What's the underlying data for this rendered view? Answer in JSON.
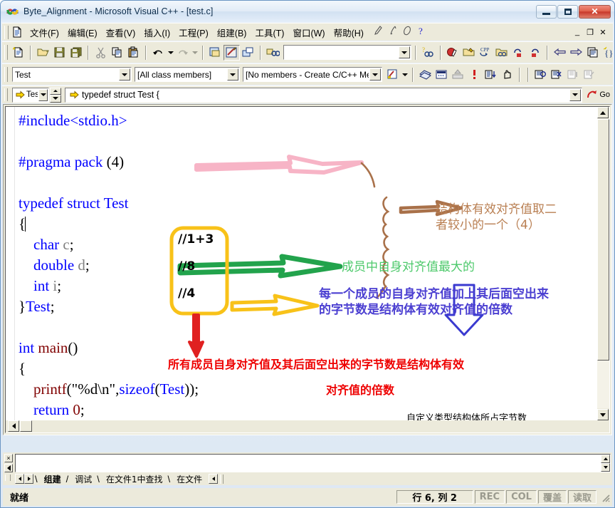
{
  "window": {
    "title": "Byte_Alignment - Microsoft Visual C++ - [test.c]",
    "app_icon": "vcpp-logo-icon",
    "minimize_label": "",
    "maximize_label": "",
    "close_label": "✕"
  },
  "menubar": {
    "items": [
      {
        "label": "文件(F)"
      },
      {
        "label": "编辑(E)"
      },
      {
        "label": "查看(V)"
      },
      {
        "label": "插入(I)"
      },
      {
        "label": "工程(P)"
      },
      {
        "label": "组建(B)"
      },
      {
        "label": "工具(T)"
      },
      {
        "label": "窗口(W)"
      },
      {
        "label": "帮助(H)"
      }
    ],
    "mdi_restore": "_",
    "mdi_max": "❐",
    "mdi_close": "✕"
  },
  "toolbar_standard": {
    "search_value": "",
    "icons": [
      "new-text-file-icon",
      "open-folder-icon",
      "save-icon",
      "save-all-icon",
      "cut-icon",
      "copy-icon",
      "paste-icon",
      "undo-icon",
      "redo-icon",
      "workspace-icon",
      "output-window-icon",
      "window-list-icon",
      "find-in-files-icon",
      "find-icon",
      "help-find-icon"
    ]
  },
  "toolbar_build": {
    "icons": [
      "compile-icon",
      "build-icon",
      "stop-build-icon",
      "execute-icon",
      "go-icon",
      "insert-breakpoint-icon",
      "toggle-breakpoint-icon",
      "remove-breakpoints-icon",
      "bookmark-icon",
      "edit-icon"
    ]
  },
  "toolbar_wizard": {
    "class_value": "Test",
    "filter_value": "[All class members]",
    "member_value": "[No members - Create C/C++ Memb",
    "icons": [
      "class-view-icon",
      "dropdown-icon"
    ]
  },
  "wizardbar": {
    "scope_value": "Tes",
    "location_value": "typedef struct Test {",
    "go_label": "Go",
    "icons": [
      "yellow-arrow-icon",
      "spinner-icon",
      "go-arrow-icon"
    ]
  },
  "editor": {
    "filename": "test.c",
    "code_lines": [
      {
        "tokens": [
          {
            "t": "#include",
            "c": "kw"
          },
          {
            "t": "<stdio.h>",
            "c": "kw"
          }
        ]
      },
      {
        "tokens": []
      },
      {
        "tokens": [
          {
            "t": "#pragma pack",
            "c": "kw"
          },
          {
            "t": " (4)",
            "c": "id"
          }
        ]
      },
      {
        "tokens": []
      },
      {
        "tokens": [
          {
            "t": "typedef struct",
            "c": "kw"
          },
          {
            "t": " ",
            "c": "id"
          },
          {
            "t": "Test",
            "c": "kw"
          }
        ]
      },
      {
        "tokens": [
          {
            "t": "{",
            "c": "id"
          }
        ],
        "cursor": true
      },
      {
        "tokens": [
          {
            "t": "    ",
            "c": "id"
          },
          {
            "t": "char",
            "c": "kw"
          },
          {
            "t": " ",
            "c": "id"
          },
          {
            "t": "c",
            "c": "gray"
          },
          {
            "t": ";",
            "c": "id"
          }
        ]
      },
      {
        "tokens": [
          {
            "t": "    ",
            "c": "id"
          },
          {
            "t": "double",
            "c": "kw"
          },
          {
            "t": " ",
            "c": "id"
          },
          {
            "t": "d",
            "c": "gray"
          },
          {
            "t": ";",
            "c": "id"
          }
        ]
      },
      {
        "tokens": [
          {
            "t": "    ",
            "c": "id"
          },
          {
            "t": "int",
            "c": "kw"
          },
          {
            "t": " ",
            "c": "id"
          },
          {
            "t": "i",
            "c": "gray"
          },
          {
            "t": ";",
            "c": "id"
          }
        ]
      },
      {
        "tokens": [
          {
            "t": "}",
            "c": "id"
          },
          {
            "t": "Test",
            "c": "kw"
          },
          {
            "t": ";",
            "c": "id"
          }
        ]
      },
      {
        "tokens": []
      },
      {
        "tokens": [
          {
            "t": "int",
            "c": "kw"
          },
          {
            "t": " ",
            "c": "id"
          },
          {
            "t": "main",
            "c": "dk"
          },
          {
            "t": "()",
            "c": "id"
          }
        ]
      },
      {
        "tokens": [
          {
            "t": "{",
            "c": "id"
          }
        ]
      },
      {
        "tokens": [
          {
            "t": "    ",
            "c": "id"
          },
          {
            "t": "printf",
            "c": "dk"
          },
          {
            "t": "(",
            "c": "id"
          },
          {
            "t": "\"%d\\n\"",
            "c": "id"
          },
          {
            "t": ",",
            "c": "id"
          },
          {
            "t": "sizeof",
            "c": "kw"
          },
          {
            "t": "(",
            "c": "id"
          },
          {
            "t": "Test",
            "c": "kw"
          },
          {
            "t": "));",
            "c": "id"
          }
        ]
      },
      {
        "tokens": [
          {
            "t": "    ",
            "c": "id"
          },
          {
            "t": "return",
            "c": "kw"
          },
          {
            "t": " ",
            "c": "id"
          },
          {
            "t": "0",
            "c": "dk"
          },
          {
            "t": ";",
            "c": "id"
          }
        ]
      },
      {
        "tokens": [
          {
            "t": "}",
            "c": "id"
          }
        ]
      }
    ]
  },
  "annotations": {
    "note_box": [
      "//1+3",
      "//8",
      "//4"
    ],
    "brown_text": "结构体有效对齐值取二\n者较小的一个（4）",
    "green_text": "成员中自身对齐值最大的",
    "blue_text": "每一个成员的自身对齐值加上其后面空出来\n的字节数是结构体有效对齐值的倍数",
    "red_text_line1": "所有成员自身对齐值及其后面空出来的字节数是结构体有效",
    "red_text_line2": "对齐值的倍数",
    "black_text": "自定义类型结构体所占字节数",
    "colors": {
      "pink_arrow": "#f9b9ca",
      "brown_arrow": "#a9714a",
      "green_arrow": "#22a34c",
      "yellow_box": "#f8c219",
      "red_arrow": "#e02020",
      "blue_arrow": "#3a3ad0",
      "brown_brace": "#a9714a"
    }
  },
  "output_pane": {
    "close_label": "×",
    "tabs": [
      {
        "label": "组建",
        "active": true
      },
      {
        "label": "调试",
        "active": false
      },
      {
        "label": "在文件1中查找",
        "active": false
      },
      {
        "label": "在文件",
        "active": false
      }
    ]
  },
  "statusbar": {
    "ready": "就绪",
    "rowcol": "行 6, 列 2",
    "indicators": [
      "REC",
      "COL",
      "覆盖",
      "读取"
    ]
  }
}
